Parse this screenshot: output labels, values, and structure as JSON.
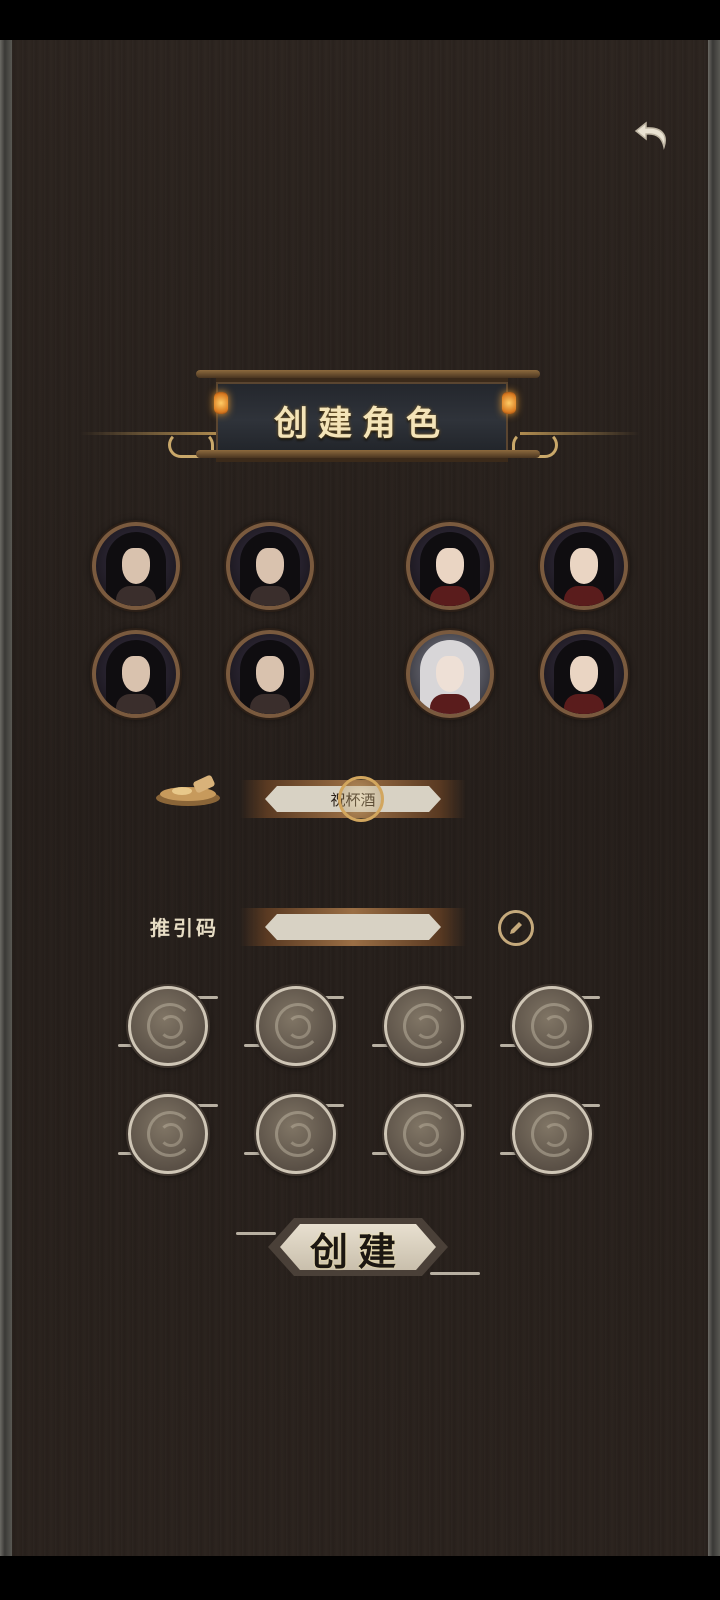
{
  "header": {
    "back_icon": "back-arrow-icon",
    "title": "创建角色"
  },
  "avatars": {
    "row1": [
      "male-portrait",
      "male-portrait",
      "female-portrait",
      "female-portrait"
    ],
    "row2": [
      "male-portrait",
      "male-portrait",
      "white-hair-female-portrait",
      "female-portrait"
    ]
  },
  "name_field": {
    "value": "祝杯酒",
    "random_icon": "dice-icon"
  },
  "invite": {
    "label": "推引码",
    "value": "",
    "edit_icon": "edit-icon"
  },
  "slots": {
    "count": 8,
    "icon": "swirl-medallion-icon"
  },
  "create_button": {
    "label": "创建"
  },
  "colors": {
    "background": "#2a221d",
    "gold": "#c9a86a",
    "title_text": "#f4e4b8"
  }
}
